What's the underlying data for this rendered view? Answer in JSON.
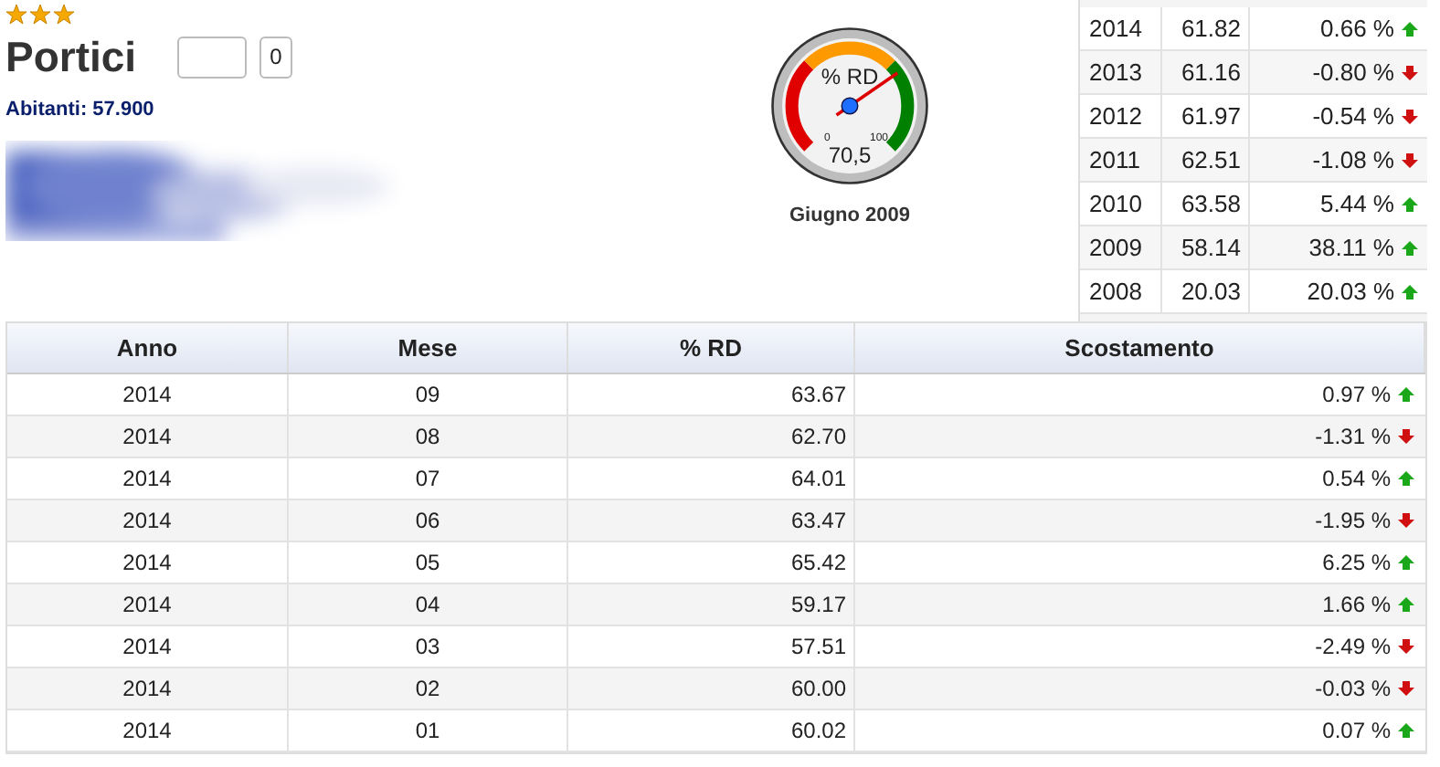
{
  "city": {
    "stars": 3,
    "name": "Portici",
    "like_count": "0",
    "population": "Abitanti: 57.900"
  },
  "gauge": {
    "label": "% RD",
    "min": "0",
    "max": "100",
    "value": "70,5",
    "caption": "Giugno 2009"
  },
  "yearly": [
    {
      "year": "2014",
      "rd": "61.82",
      "delta": "0.66 %",
      "kind": "up"
    },
    {
      "year": "2013",
      "rd": "61.16",
      "delta": "-0.80 %",
      "kind": "down"
    },
    {
      "year": "2012",
      "rd": "61.97",
      "delta": "-0.54 %",
      "kind": "down"
    },
    {
      "year": "2011",
      "rd": "62.51",
      "delta": "-1.08 %",
      "kind": "down"
    },
    {
      "year": "2010",
      "rd": "63.58",
      "delta": "5.44 %",
      "kind": "up"
    },
    {
      "year": "2009",
      "rd": "58.14",
      "delta": "38.11 %",
      "kind": "up"
    },
    {
      "year": "2008",
      "rd": "20.03",
      "delta": "20.03 %",
      "kind": "up"
    }
  ],
  "table": {
    "columns": [
      "Anno",
      "Mese",
      "% RD",
      "Scostamento"
    ],
    "rows": [
      {
        "anno": "2014",
        "mese": "09",
        "rd": "63.67",
        "delta": "0.97 %",
        "kind": "up"
      },
      {
        "anno": "2014",
        "mese": "08",
        "rd": "62.70",
        "delta": "-1.31 %",
        "kind": "down"
      },
      {
        "anno": "2014",
        "mese": "07",
        "rd": "64.01",
        "delta": "0.54 %",
        "kind": "up"
      },
      {
        "anno": "2014",
        "mese": "06",
        "rd": "63.47",
        "delta": "-1.95 %",
        "kind": "down"
      },
      {
        "anno": "2014",
        "mese": "05",
        "rd": "65.42",
        "delta": "6.25 %",
        "kind": "up"
      },
      {
        "anno": "2014",
        "mese": "04",
        "rd": "59.17",
        "delta": "1.66 %",
        "kind": "up"
      },
      {
        "anno": "2014",
        "mese": "03",
        "rd": "57.51",
        "delta": "-2.49 %",
        "kind": "down"
      },
      {
        "anno": "2014",
        "mese": "02",
        "rd": "60.00",
        "delta": "-0.03 %",
        "kind": "down"
      },
      {
        "anno": "2014",
        "mese": "01",
        "rd": "60.02",
        "delta": "0.07 %",
        "kind": "up"
      }
    ]
  }
}
